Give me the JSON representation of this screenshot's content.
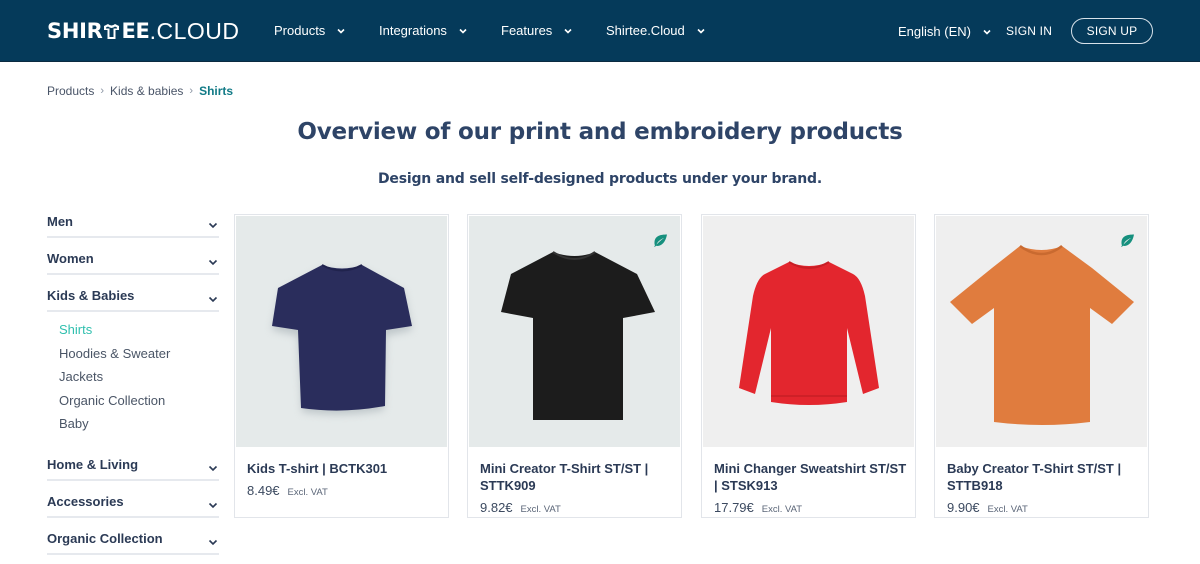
{
  "header": {
    "logo_bold_prefix": "SHIR",
    "logo_bold_suffix": "EE",
    "logo_thin": ".CLOUD",
    "nav": [
      {
        "label": "Products"
      },
      {
        "label": "Integrations"
      },
      {
        "label": "Features"
      },
      {
        "label": "Shirtee.Cloud"
      }
    ],
    "language": "English (EN)",
    "sign_in": "SIGN IN",
    "sign_up": "SIGN UP"
  },
  "breadcrumb": {
    "items": [
      "Products",
      "Kids & babies"
    ],
    "current": "Shirts",
    "separator": "›"
  },
  "page": {
    "title": "Overview of our print and embroidery products",
    "subtitle": "Design and sell self-designed products under your brand."
  },
  "sidebar": {
    "categories": [
      {
        "label": "Men"
      },
      {
        "label": "Women"
      },
      {
        "label": "Kids & Babies"
      },
      {
        "label": "Home & Living"
      },
      {
        "label": "Accessories"
      },
      {
        "label": "Organic Collection"
      }
    ],
    "kids_subcategories": [
      {
        "label": "Shirts",
        "active": true
      },
      {
        "label": "Hoodies & Sweater"
      },
      {
        "label": "Jackets"
      },
      {
        "label": "Organic Collection"
      },
      {
        "label": "Baby"
      }
    ]
  },
  "products": [
    {
      "name": "Kids T-shirt | BCTK301",
      "price": "8.49€",
      "vat": "Excl. VAT",
      "organic": false,
      "icon": "navy-tshirt",
      "color": "#2a2d5c"
    },
    {
      "name": "Mini Creator T-Shirt ST/ST | STTK909",
      "price": "9.82€",
      "vat": "Excl. VAT",
      "organic": true,
      "icon": "black-tshirt",
      "color": "#1c1c1c"
    },
    {
      "name": "Mini Changer Sweatshirt ST/ST | STSK913",
      "price": "17.79€",
      "vat": "Excl. VAT",
      "organic": false,
      "icon": "red-sweatshirt",
      "color": "#e3262e"
    },
    {
      "name": "Baby Creator T-Shirt ST/ST | STTB918",
      "price": "9.90€",
      "vat": "Excl. VAT",
      "organic": true,
      "icon": "orange-tshirt",
      "color": "#e07c3e"
    }
  ],
  "colors": {
    "header_bg": "#053a5a",
    "accent_teal": "#117a86",
    "active_sub": "#2fbfae",
    "organic_leaf": "#16907e",
    "heading": "#2e4467"
  }
}
